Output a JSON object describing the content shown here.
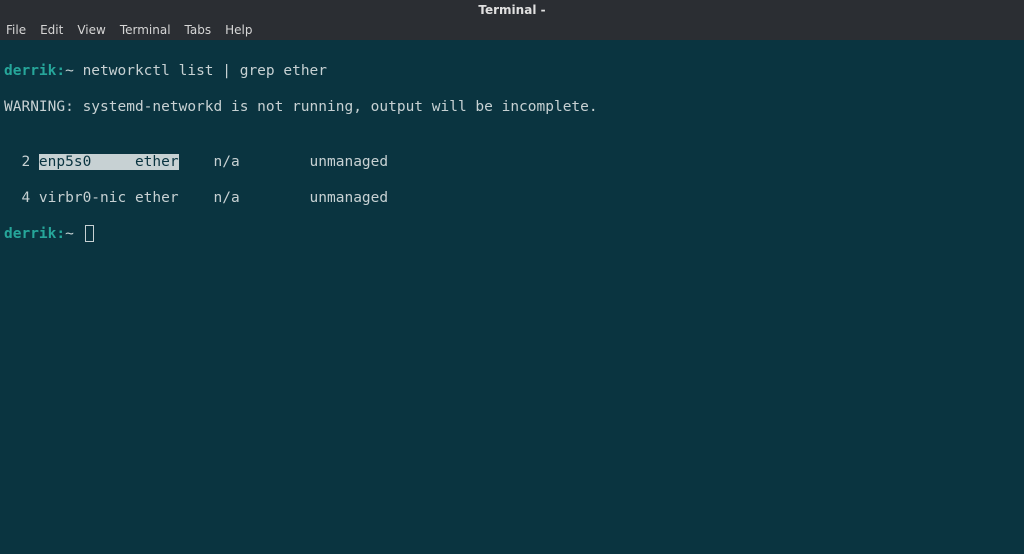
{
  "titlebar": {
    "title": "Terminal -"
  },
  "menubar": {
    "file": "File",
    "edit": "Edit",
    "view": "View",
    "terminal": "Terminal",
    "tabs": "Tabs",
    "help": "Help"
  },
  "terminal": {
    "prompt_host": "derrik:",
    "prompt_tilde": "~ ",
    "command1": "networkctl list | grep ether",
    "warning": "WARNING: systemd-networkd is not running, output will be incomplete.",
    "blank": "",
    "row1_idx": "  2 ",
    "row1_highlighted": "enp5s0     ether",
    "row1_rest": "    n/a        unmanaged",
    "row2": "  4 virbr0-nic ether    n/a        unmanaged"
  }
}
